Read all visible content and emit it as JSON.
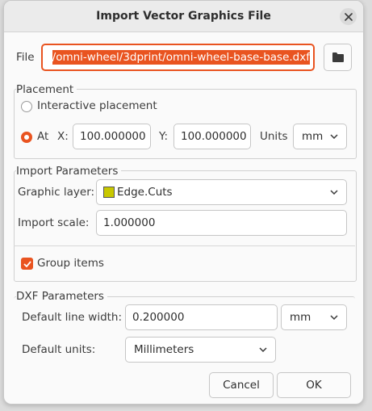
{
  "window": {
    "title": "Import Vector Graphics File"
  },
  "file": {
    "label": "File",
    "path": "/omni-wheel/3dprint/omni-wheel-base-base.dxf",
    "browse_icon": "folder-icon"
  },
  "placement": {
    "title": "Placement",
    "interactive_label": "Interactive placement",
    "at_label": "At",
    "x_label": "X:",
    "x_value": "100.000000",
    "y_label": "Y:",
    "y_value": "100.000000",
    "units_label": "Units",
    "units_value": "mm",
    "selected": "at"
  },
  "import_params": {
    "title": "Import Parameters",
    "layer_label": "Graphic layer:",
    "layer_value": "Edge.Cuts",
    "layer_color": "#c8c800",
    "scale_label": "Import scale:",
    "scale_value": "1.000000",
    "group_label": "Group items",
    "group_checked": true
  },
  "dxf": {
    "title": "DXF Parameters",
    "line_width_label": "Default line width:",
    "line_width_value": "0.200000",
    "line_width_units": "mm",
    "units_label": "Default units:",
    "units_value": "Millimeters"
  },
  "buttons": {
    "cancel_label": "Cancel",
    "ok_label": "OK"
  },
  "colors": {
    "accent": "#e95420"
  }
}
